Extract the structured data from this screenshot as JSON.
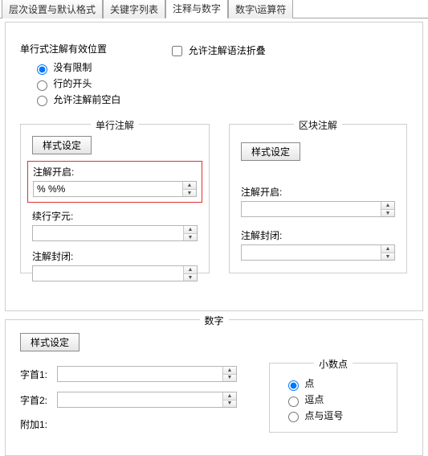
{
  "tabs": {
    "t0": "层次设置与默认格式",
    "t1": "关键字列表",
    "t2": "注释与数字",
    "t3": "数字\\运算符",
    "active_index": 2
  },
  "single_line_pos": {
    "title": "单行式注解有效位置",
    "opt_none": "没有限制",
    "opt_line_start": "行的开头",
    "opt_allow_ws": "允许注解前空白",
    "selected": "opt_none"
  },
  "allow_fold": {
    "label": "允许注解语法折叠",
    "checked": false
  },
  "single_comment": {
    "legend": "单行注解",
    "style_btn": "样式设定",
    "open_label": "注解开启:",
    "open_value": "% %%",
    "cont_label": "续行字元:",
    "cont_value": "",
    "close_label": "注解封闭:",
    "close_value": ""
  },
  "block_comment": {
    "legend": "区块注解",
    "style_btn": "样式设定",
    "open_label": "注解开启:",
    "open_value": "",
    "close_label": "注解封闭:",
    "close_value": ""
  },
  "numbers": {
    "legend": "数字",
    "style_btn": "样式设定",
    "prefix1_label": "字首1:",
    "prefix1_value": "",
    "prefix2_label": "字首2:",
    "prefix2_value": "",
    "extra1_label": "附加1:"
  },
  "decimal": {
    "legend": "小数点",
    "opt_dot": "点",
    "opt_comma": "逗点",
    "opt_both": "点与逗号",
    "selected": "opt_dot"
  }
}
